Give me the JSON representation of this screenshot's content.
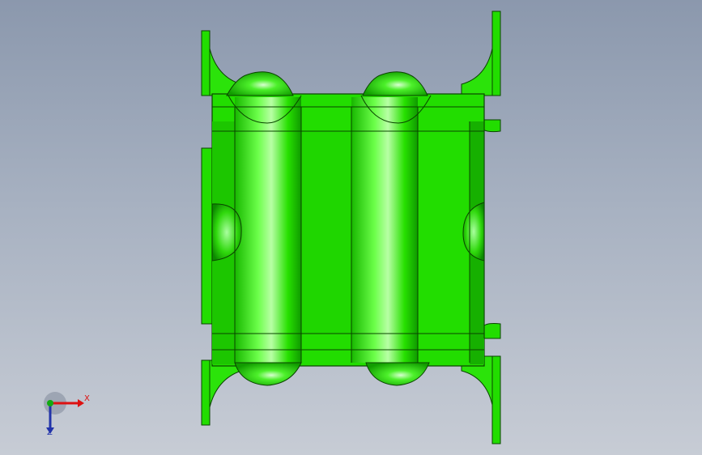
{
  "viewport": {
    "background_top": "#8b98ad",
    "background_bottom": "#c7ccd5"
  },
  "model": {
    "part_color": "#22dd00",
    "edge_color": "#0a4400",
    "highlight_color": "#a8ff90",
    "shadow_color": "#0c8a00"
  },
  "triad": {
    "x_label": "X",
    "z_label": "Z",
    "x_color": "#dd1111",
    "y_color": "#11aa11",
    "z_color": "#2233aa"
  }
}
